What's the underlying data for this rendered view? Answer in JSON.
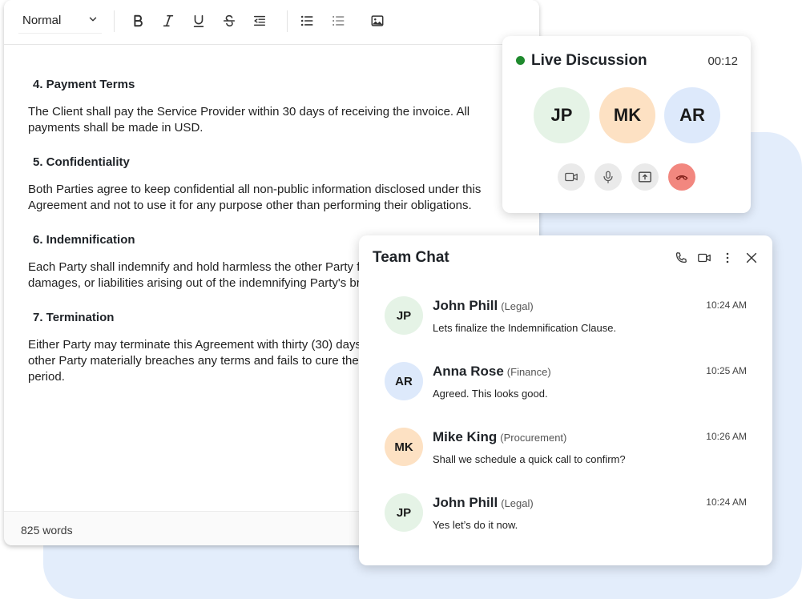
{
  "editor": {
    "toolbar": {
      "style_value": "Normal",
      "icons": [
        "bold-icon",
        "italic-icon",
        "underline-icon",
        "strikethrough-icon",
        "indent-icon",
        "bulleted-list-icon",
        "numbered-list-icon",
        "image-icon"
      ]
    },
    "sections": [
      {
        "heading": "4. Payment Terms",
        "body": "The Client shall pay the Service Provider within 30 days of receiving the invoice. All payments shall be made in USD."
      },
      {
        "heading": "5. Confidentiality",
        "body": "Both Parties agree to keep confidential all non-public information disclosed under this Agreement and not to use it for any purpose other than performing their obligations."
      },
      {
        "heading": "6. Indemnification",
        "body": "Each Party shall indemnify and hold harmless the other Party from any claims, damages, or liabilities arising out of the indemnifying Party's breach of this Agreement."
      },
      {
        "heading": "7. Termination",
        "body": "Either Party may terminate this Agreement with thirty (30) days written notice if the other Party materially breaches any terms and fails to cure the breach within that period."
      }
    ],
    "word_count": "825 words"
  },
  "call": {
    "title": "Live Discussion",
    "timer": "00:12",
    "status_color": "#1f8a2e",
    "participants": [
      {
        "initials": "JP",
        "color": "#e5f3e6"
      },
      {
        "initials": "MK",
        "color": "#fde1c3"
      },
      {
        "initials": "AR",
        "color": "#dde9fb"
      }
    ],
    "controls": [
      "video-icon",
      "microphone-icon",
      "share-screen-icon",
      "end-call-icon"
    ]
  },
  "chat": {
    "title": "Team Chat",
    "header_icons": [
      "phone-icon",
      "video-icon",
      "more-vertical-icon",
      "close-icon"
    ],
    "messages": [
      {
        "initials": "JP",
        "color": "#e5f3e6",
        "name": "John Phill",
        "role": "(Legal)",
        "time": "10:24 AM",
        "text": "Lets finalize the Indemnification Clause."
      },
      {
        "initials": "AR",
        "color": "#dde9fb",
        "name": "Anna Rose",
        "role": "(Finance)",
        "time": "10:25 AM",
        "text": "Agreed. This looks good."
      },
      {
        "initials": "MK",
        "color": "#fde1c3",
        "name": "Mike King",
        "role": "(Procurement)",
        "time": "10:26 AM",
        "text": "Shall we schedule a quick call to confirm?"
      },
      {
        "initials": "JP",
        "color": "#e5f3e6",
        "name": "John Phill",
        "role": "(Legal)",
        "time": "10:24 AM",
        "text": "Yes let’s do it now."
      }
    ]
  }
}
